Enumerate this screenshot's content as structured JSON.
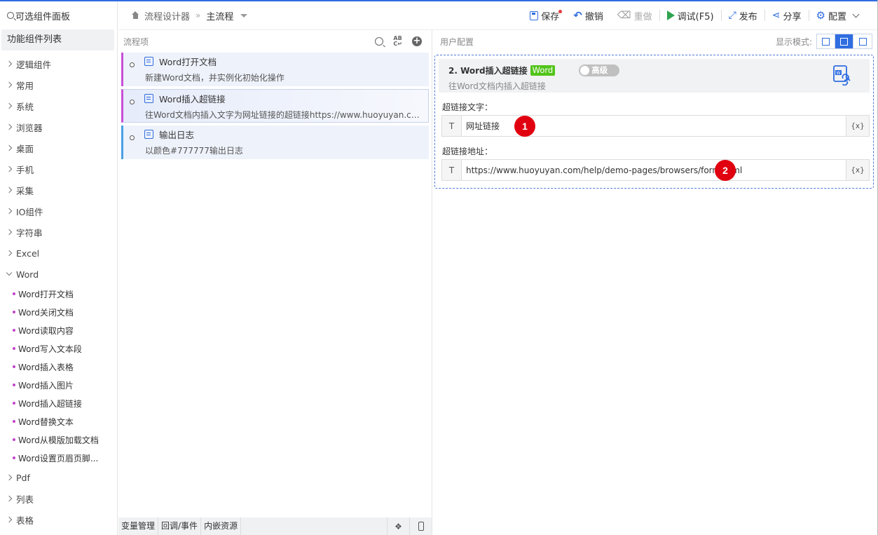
{
  "sidebar": {
    "search_label": "可选组件面板",
    "title": "功能组件列表",
    "categories": [
      "逻辑组件",
      "常用",
      "系统",
      "浏览器",
      "桌面",
      "手机",
      "采集",
      "IO组件",
      "字符串",
      "Excel"
    ],
    "open_category": "Word",
    "word_items": [
      "Word打开文档",
      "Word关闭文档",
      "Word读取内容",
      "Word写入文本段",
      "Word插入表格",
      "Word插入图片",
      "Word插入超链接",
      "Word替换文本",
      "Word从模版加载文档",
      "Word设置页眉页脚..."
    ],
    "after_categories": [
      "Pdf",
      "列表",
      "表格"
    ],
    "dot_color": "#c044c8"
  },
  "header": {
    "breadcrumb_root": "流程设计器",
    "breadcrumb_current": "主流程",
    "save": "保存",
    "undo": "撤销",
    "redo": "重做",
    "debug": "调试(F5)",
    "publish": "发布",
    "share": "分享",
    "config": "配置"
  },
  "flow": {
    "title": "流程项",
    "steps": [
      {
        "title": "Word打开文档",
        "desc": "新建Word文档，并实例化初始化操作"
      },
      {
        "title": "Word插入超链接",
        "desc": "往Word文档内插入文字为网址链接的超链接https://www.huoyuyan.com/..."
      },
      {
        "title": "输出日志",
        "desc": "以颜色#777777输出日志"
      }
    ],
    "footer_tabs": [
      "变量管理",
      "回调/事件",
      "内嵌资源"
    ]
  },
  "config": {
    "title": "用户配置",
    "display_mode_label": "显示模式:",
    "card_title": "2. Word插入超链接",
    "card_badge": "Word",
    "advanced_label": "高级",
    "card_desc": "往Word文档内插入超链接",
    "field1_label": "超链接文字：",
    "field1_type": "T",
    "field1_value": "网址链接",
    "field2_label": "超链接地址：",
    "field2_type": "T",
    "field2_value": "https://www.huoyuyan.com/help/demo-pages/browsers/form.html",
    "var_button": "{x}",
    "marker1": "1",
    "marker2": "2"
  },
  "colors": {
    "accent": "#2f6de1",
    "badge_green": "#52c41a",
    "marker_red": "#e1000f",
    "step_border": "#c84fd6",
    "log_border": "#4aa0e6"
  }
}
